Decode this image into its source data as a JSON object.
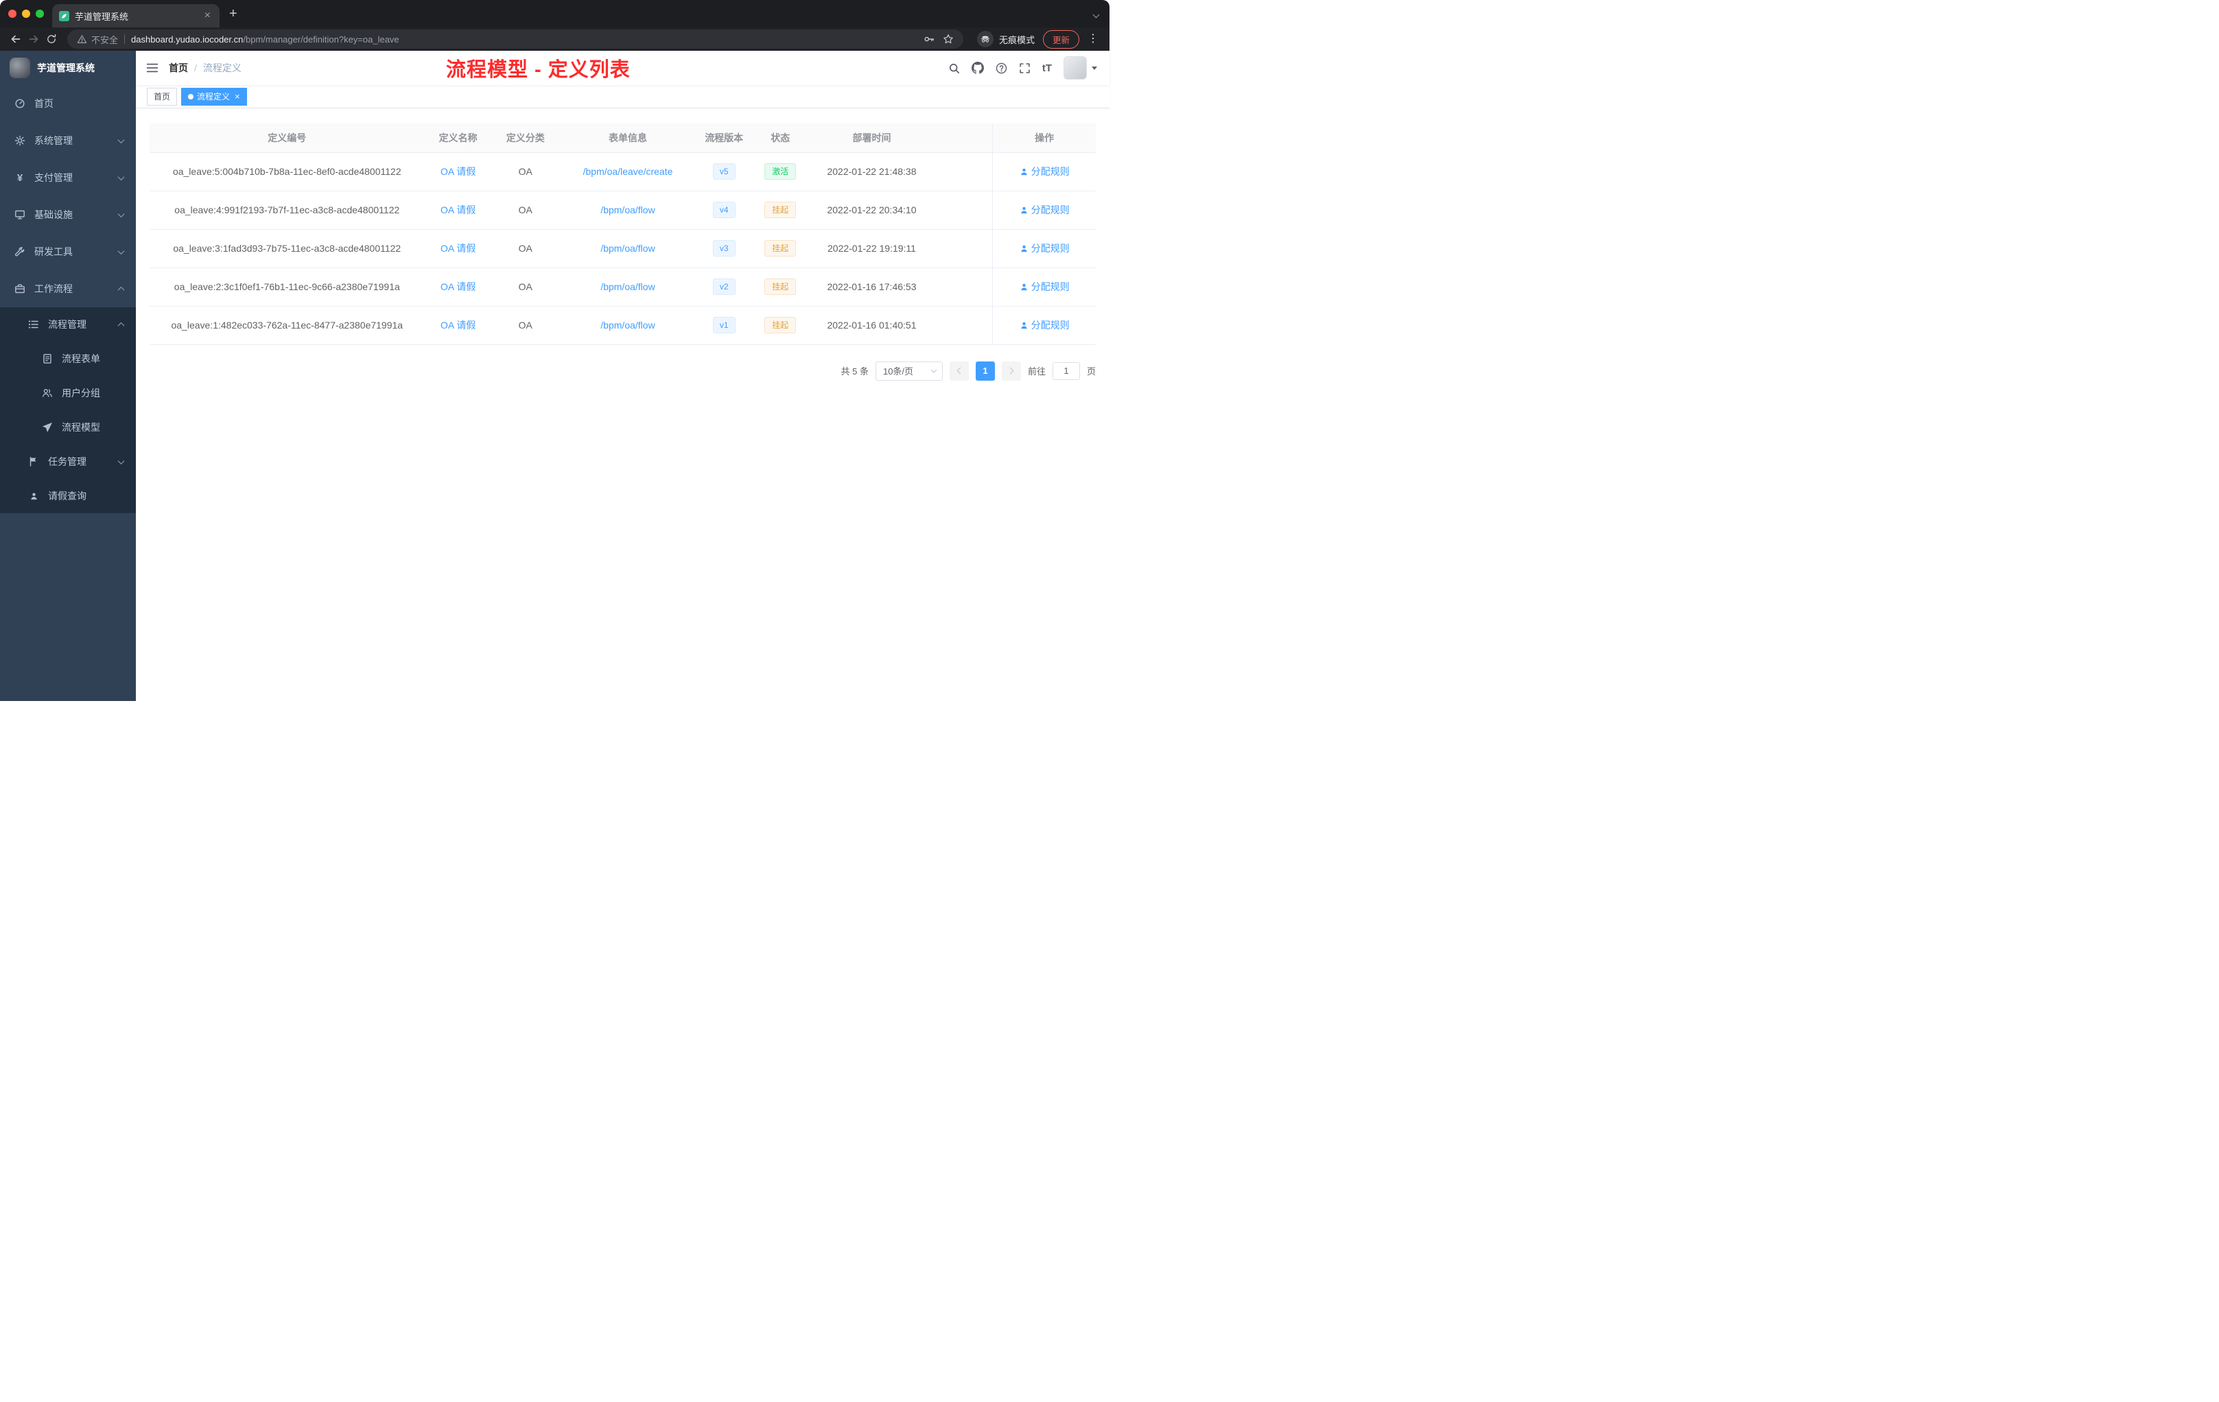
{
  "colors": {
    "accent": "#409eff",
    "success": "#13ce66",
    "warning": "#e6a23c",
    "annotation_red": "#fc2b2b",
    "sidebar_bg": "#304156",
    "submenu_bg": "#1f2d3d"
  },
  "icons": {
    "tab_close": "×",
    "tag_close": "×",
    "new_tab": "+",
    "menu_kebab": "⋮",
    "breadcrumb_separator": "/",
    "font_size_icon_text": "tT"
  },
  "browser": {
    "tab_title": "芋道管理系统",
    "security_label": "不安全",
    "url_host": "dashboard.yudao.iocoder.cn",
    "url_path": "/bpm/manager/definition?key=oa_leave",
    "incognito_label": "无痕模式",
    "update_label": "更新"
  },
  "sidebar": {
    "logo_title": "芋道管理系统",
    "items": [
      {
        "key": "home",
        "label": "首页",
        "icon": "dashboard-icon",
        "level": 1,
        "chevron": null,
        "submenu": false
      },
      {
        "key": "system-management",
        "label": "系统管理",
        "icon": "gear-icon",
        "level": 1,
        "chevron": "down",
        "submenu": false
      },
      {
        "key": "payment-management",
        "label": "支付管理",
        "icon": "yen-icon",
        "level": 1,
        "chevron": "down",
        "submenu": false
      },
      {
        "key": "infrastructure",
        "label": "基础设施",
        "icon": "monitor-icon",
        "level": 1,
        "chevron": "down",
        "submenu": false
      },
      {
        "key": "dev-tools",
        "label": "研发工具",
        "icon": "tool-icon",
        "level": 1,
        "chevron": "down",
        "submenu": false
      },
      {
        "key": "workflow",
        "label": "工作流程",
        "icon": "briefcase-icon",
        "level": 1,
        "chevron": "up",
        "submenu": false
      },
      {
        "key": "process-management",
        "label": "流程管理",
        "icon": "list-icon",
        "level": 2,
        "chevron": "up",
        "submenu": true
      },
      {
        "key": "process-form",
        "label": "流程表单",
        "icon": "document-icon",
        "level": 3,
        "chevron": null,
        "submenu": true
      },
      {
        "key": "user-group",
        "label": "用户分组",
        "icon": "users-icon",
        "level": 3,
        "chevron": null,
        "submenu": true
      },
      {
        "key": "process-model",
        "label": "流程模型",
        "icon": "send-icon",
        "level": 3,
        "chevron": null,
        "submenu": true
      },
      {
        "key": "task-management",
        "label": "任务管理",
        "icon": "task-icon",
        "level": 2,
        "chevron": "down",
        "submenu": true
      },
      {
        "key": "leave-query",
        "label": "请假查询",
        "icon": "user-icon",
        "level": 2,
        "chevron": null,
        "submenu": true
      }
    ]
  },
  "header": {
    "breadcrumb": [
      {
        "label": "首页"
      },
      {
        "label": "流程定义"
      }
    ],
    "annotation": "流程模型 - 定义列表"
  },
  "tags": [
    {
      "label": "首页",
      "active": false,
      "closable": false
    },
    {
      "label": "流程定义",
      "active": true,
      "closable": true
    }
  ],
  "table": {
    "columns": [
      "定义编号",
      "定义名称",
      "定义分类",
      "表单信息",
      "流程版本",
      "状态",
      "部署时间",
      "操作"
    ],
    "rows": [
      {
        "id": "oa_leave:5:004b710b-7b8a-11ec-8ef0-acde48001122",
        "name": "OA 请假",
        "category": "OA",
        "form": "/bpm/oa/leave/create",
        "version": "v5",
        "status": "激活",
        "status_type": "success",
        "time": "2022-01-22 21:48:38",
        "action": "分配规则"
      },
      {
        "id": "oa_leave:4:991f2193-7b7f-11ec-a3c8-acde48001122",
        "name": "OA 请假",
        "category": "OA",
        "form": "/bpm/oa/flow",
        "version": "v4",
        "status": "挂起",
        "status_type": "warning",
        "time": "2022-01-22 20:34:10",
        "action": "分配规则"
      },
      {
        "id": "oa_leave:3:1fad3d93-7b75-11ec-a3c8-acde48001122",
        "name": "OA 请假",
        "category": "OA",
        "form": "/bpm/oa/flow",
        "version": "v3",
        "status": "挂起",
        "status_type": "warning",
        "time": "2022-01-22 19:19:11",
        "action": "分配规则"
      },
      {
        "id": "oa_leave:2:3c1f0ef1-76b1-11ec-9c66-a2380e71991a",
        "name": "OA 请假",
        "category": "OA",
        "form": "/bpm/oa/flow",
        "version": "v2",
        "status": "挂起",
        "status_type": "warning",
        "time": "2022-01-16 17:46:53",
        "action": "分配规则"
      },
      {
        "id": "oa_leave:1:482ec033-762a-11ec-8477-a2380e71991a",
        "name": "OA 请假",
        "category": "OA",
        "form": "/bpm/oa/flow",
        "version": "v1",
        "status": "挂起",
        "status_type": "warning",
        "time": "2022-01-16 01:40:51",
        "action": "分配规则"
      }
    ]
  },
  "pagination": {
    "total_label": "共 5 条",
    "page_size_label": "10条/页",
    "current_page": "1",
    "goto_label": "前往",
    "goto_value": "1",
    "unit_label": "页"
  }
}
